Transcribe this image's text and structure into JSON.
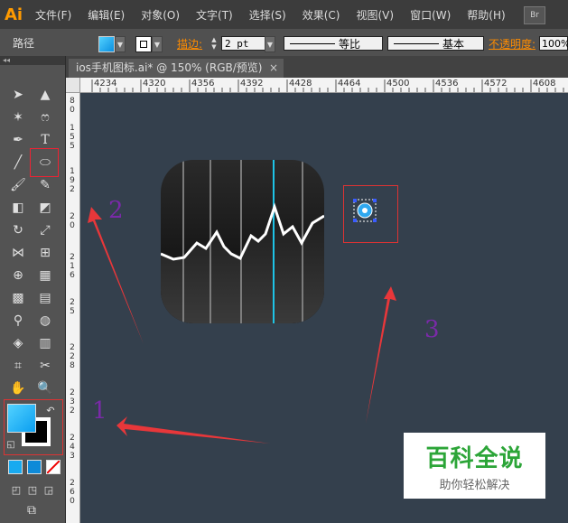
{
  "app": {
    "logo": "Ai"
  },
  "menu": [
    "文件(F)",
    "编辑(E)",
    "对象(O)",
    "文字(T)",
    "选择(S)",
    "效果(C)",
    "视图(V)",
    "窗口(W)",
    "帮助(H)"
  ],
  "bridge_label": "Br",
  "control_bar": {
    "selection_label": "路径",
    "stroke_label": "描边:",
    "stroke_weight": "2 pt",
    "profile_1": "等比",
    "profile_2": "基本",
    "opacity_label": "不透明度:",
    "opacity_value": "100%"
  },
  "document_tab": {
    "title": "ios手机图标.ai* @ 150% (RGB/预览)",
    "close": "×"
  },
  "ruler": {
    "h_ticks": [
      "4234",
      "4320",
      "4356",
      "4392",
      "4428",
      "4464",
      "4500",
      "4536",
      "4572",
      "4608"
    ],
    "v_ticks": [
      "8",
      "0",
      "1",
      "5",
      "5",
      "1",
      "9",
      "2",
      "2",
      "0",
      "2",
      "1",
      "6",
      "2",
      "5",
      "2",
      "2",
      "8",
      "2",
      "3",
      "2",
      "2",
      "4",
      "3",
      "2",
      "6",
      "0"
    ]
  },
  "annotations": {
    "one": "1",
    "two": "2",
    "three": "3"
  },
  "watermark": {
    "title": "百科全说",
    "subtitle": "助你轻松解决"
  },
  "colors": {
    "fill_gradient_start": "#53d2ff",
    "fill_gradient_end": "#0a8fe0",
    "accent_line": "#1ec3e6",
    "arrow": "#e8373a",
    "annotation": "#7a2aa8"
  }
}
